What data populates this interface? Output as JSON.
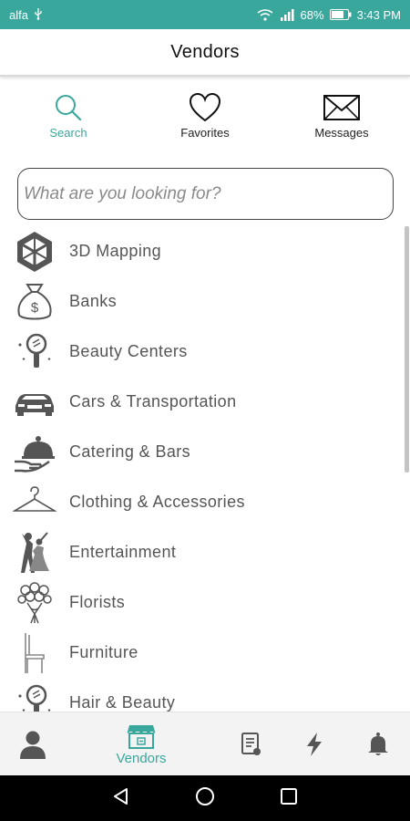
{
  "status_bar": {
    "carrier": "alfa",
    "battery": "68%",
    "time": "3:43 PM"
  },
  "header": {
    "title": "Vendors"
  },
  "top_tabs": [
    {
      "label": "Search",
      "icon": "search-icon",
      "active": true
    },
    {
      "label": "Favorites",
      "icon": "heart-icon",
      "active": false
    },
    {
      "label": "Messages",
      "icon": "envelope-icon",
      "active": false
    }
  ],
  "search": {
    "placeholder": "What are you looking for?",
    "value": ""
  },
  "categories": [
    {
      "label": "3D Mapping",
      "icon": "cube-icon"
    },
    {
      "label": "Banks",
      "icon": "money-bag-icon"
    },
    {
      "label": "Beauty Centers",
      "icon": "hand-mirror-icon"
    },
    {
      "label": "Cars & Transportation",
      "icon": "car-icon"
    },
    {
      "label": "Catering & Bars",
      "icon": "cloche-icon"
    },
    {
      "label": "Clothing & Accessories",
      "icon": "hanger-icon"
    },
    {
      "label": "Entertainment",
      "icon": "dancers-icon"
    },
    {
      "label": "Florists",
      "icon": "bouquet-icon"
    },
    {
      "label": "Furniture",
      "icon": "chair-icon"
    },
    {
      "label": "Hair & Beauty",
      "icon": "hand-mirror-icon"
    }
  ],
  "bottom_nav": {
    "vendors_label": "Vendors",
    "items": [
      {
        "icon": "profile-icon"
      },
      {
        "icon": "storefront-icon",
        "label": "Vendors",
        "active": true
      },
      {
        "icon": "checklist-icon"
      },
      {
        "icon": "lightning-icon"
      },
      {
        "icon": "bell-icon"
      }
    ]
  },
  "colors": {
    "accent": "#3aa79d",
    "status_bar": "#3aa79d",
    "icon_gray": "#555555",
    "label_gray": "#555555"
  }
}
